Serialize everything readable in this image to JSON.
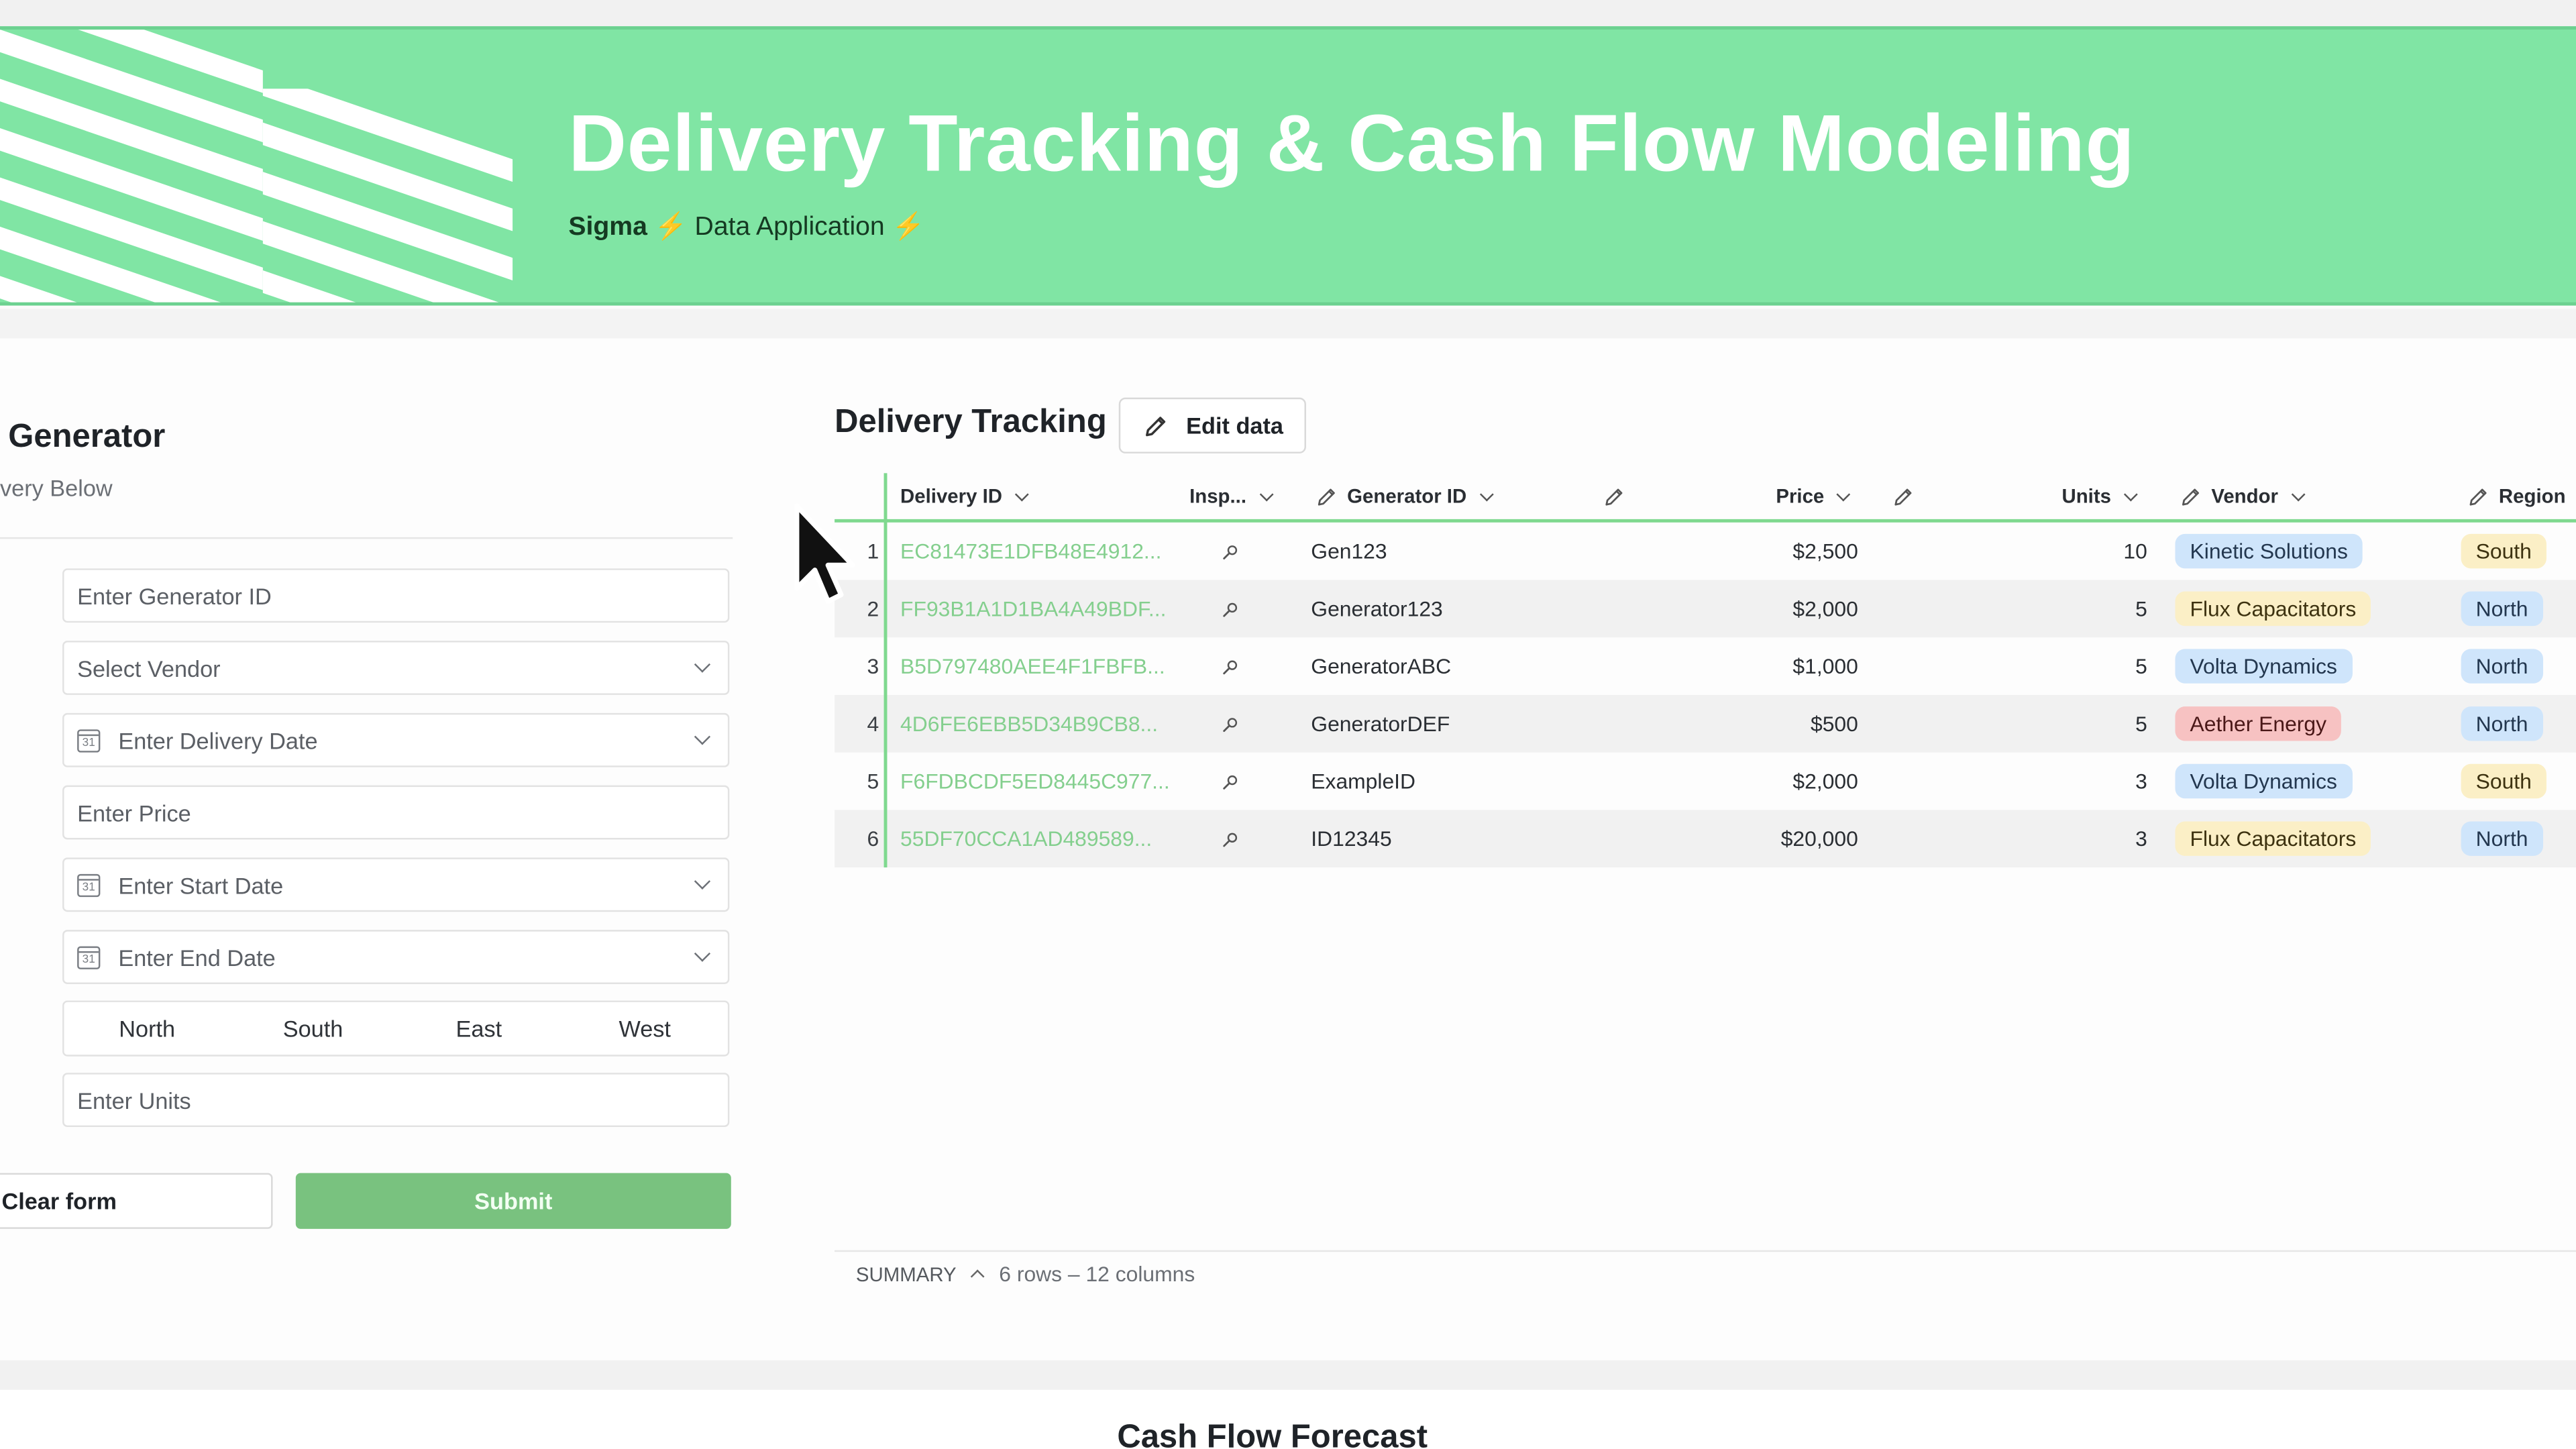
{
  "banner": {
    "title": "Delivery Tracking & Cash Flow Modeling",
    "brand": "Sigma",
    "bolt": "⚡",
    "subtitle": "Data Application",
    "color": "#80e5a4"
  },
  "form": {
    "title": "Generator",
    "subtitle": "very Below",
    "fields": {
      "generator_id_placeholder": "Enter Generator ID",
      "vendor_placeholder": "Select Vendor",
      "delivery_date_placeholder": "Enter Delivery Date",
      "price_placeholder": "Enter Price",
      "start_date_placeholder": "Enter Start Date",
      "end_date_placeholder": "Enter End Date",
      "units_placeholder": "Enter Units"
    },
    "regions": [
      "North",
      "South",
      "East",
      "West"
    ],
    "clear_label": "Clear form",
    "submit_label": "Submit",
    "submit_color": "#79c27f"
  },
  "table": {
    "title": "Delivery Tracking",
    "edit_label": "Edit data",
    "headers": {
      "delivery_id": "Delivery ID",
      "inspect": "Insp...",
      "generator_id": "Generator ID",
      "price": "Price",
      "units": "Units",
      "vendor": "Vendor",
      "region": "Region"
    },
    "rows": [
      {
        "num": "1",
        "delivery_id": "EC81473E1DFB48E4912...",
        "generator_id": "Gen123",
        "price": "$2,500",
        "units": "10",
        "vendor": "Kinetic Solutions",
        "vendor_color": "blue",
        "region": "South",
        "region_color": "yellow"
      },
      {
        "num": "2",
        "delivery_id": "FF93B1A1D1BA4A49BDF...",
        "generator_id": "Generator123",
        "price": "$2,000",
        "units": "5",
        "vendor": "Flux Capacitators",
        "vendor_color": "yellow",
        "region": "North",
        "region_color": "blue"
      },
      {
        "num": "3",
        "delivery_id": "B5D797480AEE4F1FBFB...",
        "generator_id": "GeneratorABC",
        "price": "$1,000",
        "units": "5",
        "vendor": "Volta Dynamics",
        "vendor_color": "blue",
        "region": "North",
        "region_color": "blue"
      },
      {
        "num": "4",
        "delivery_id": "4D6FE6EBB5D34B9CB8...",
        "generator_id": "GeneratorDEF",
        "price": "$500",
        "units": "5",
        "vendor": "Aether Energy",
        "vendor_color": "red",
        "region": "North",
        "region_color": "blue"
      },
      {
        "num": "5",
        "delivery_id": "F6FDBCDF5ED8445C977...",
        "generator_id": "ExampleID",
        "price": "$2,000",
        "units": "3",
        "vendor": "Volta Dynamics",
        "vendor_color": "blue",
        "region": "South",
        "region_color": "yellow"
      },
      {
        "num": "6",
        "delivery_id": "55DF70CCA1AD489589...",
        "generator_id": "ID12345",
        "price": "$20,000",
        "units": "3",
        "vendor": "Flux Capacitators",
        "vendor_color": "yellow",
        "region": "North",
        "region_color": "blue"
      }
    ],
    "summary_label": "SUMMARY",
    "summary_info": "6 rows – 12 columns"
  },
  "cash_flow": {
    "title": "Cash Flow Forecast"
  },
  "colors": {
    "accent_green": "#7fd98f",
    "link_green": "#84cf8e",
    "pill_blue": "#cfe5fb",
    "pill_yellow": "#fbefc6",
    "pill_red": "#f7c2c2"
  }
}
